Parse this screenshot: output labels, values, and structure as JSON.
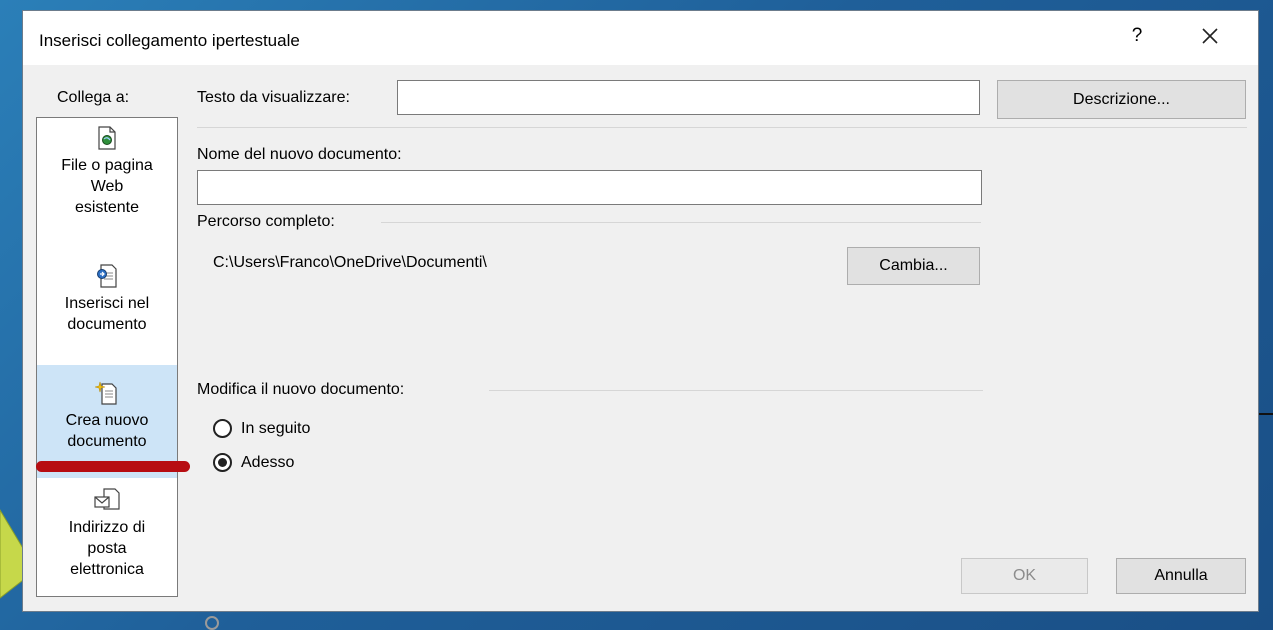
{
  "dialog": {
    "title": "Inserisci collegamento ipertestuale",
    "help_label": "?",
    "close_icon": "close-icon"
  },
  "link_to": {
    "label": "Collega a:",
    "items": [
      {
        "label": "File o pagina\nWeb\nesistente",
        "icon": "web-page-icon",
        "selected": false
      },
      {
        "label": "Inserisci nel\ndocumento",
        "icon": "place-in-document-icon",
        "selected": false
      },
      {
        "label": "Crea nuovo\ndocumento",
        "icon": "new-document-icon",
        "selected": true
      },
      {
        "label": "Indirizzo di\nposta\nelettronica",
        "icon": "email-icon",
        "selected": false
      }
    ]
  },
  "display_text": {
    "label": "Testo da visualizzare:",
    "value": ""
  },
  "description_button": "Descrizione...",
  "new_document": {
    "label": "Nome del nuovo documento:",
    "value": ""
  },
  "full_path": {
    "label": "Percorso completo:",
    "value": "C:\\Users\\Franco\\OneDrive\\Documenti\\",
    "change_button": "Cambia..."
  },
  "edit_new_document": {
    "label": "Modifica il nuovo documento:",
    "options": [
      {
        "label": "In seguito",
        "checked": false
      },
      {
        "label": "Adesso",
        "checked": true
      }
    ]
  },
  "buttons": {
    "ok": "OK",
    "cancel": "Annulla"
  },
  "colors": {
    "selected_item": "#cde4f7",
    "annotation_mark": "#b70d12",
    "background": "#2b7fb8"
  }
}
